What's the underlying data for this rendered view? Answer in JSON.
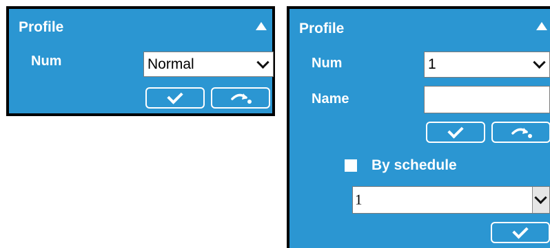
{
  "left_panel": {
    "title": "Profile",
    "num_label": "Num",
    "num_value": "Normal",
    "collapse_icon": "triangle-up-icon",
    "confirm_icon": "checkmark-icon",
    "skip_icon": "skip-arrow-icon"
  },
  "right_panel": {
    "title": "Profile",
    "num_label": "Num",
    "num_value": "1",
    "name_label": "Name",
    "name_value": "",
    "schedule_label": "By schedule",
    "schedule_checked": false,
    "schedule_value": "1",
    "collapse_icon": "triangle-up-icon",
    "confirm_icon": "checkmark-icon",
    "skip_icon": "skip-arrow-icon"
  },
  "colors": {
    "panel_bg": "#2b96d2",
    "frame": "#000000",
    "text": "#ffffff"
  }
}
